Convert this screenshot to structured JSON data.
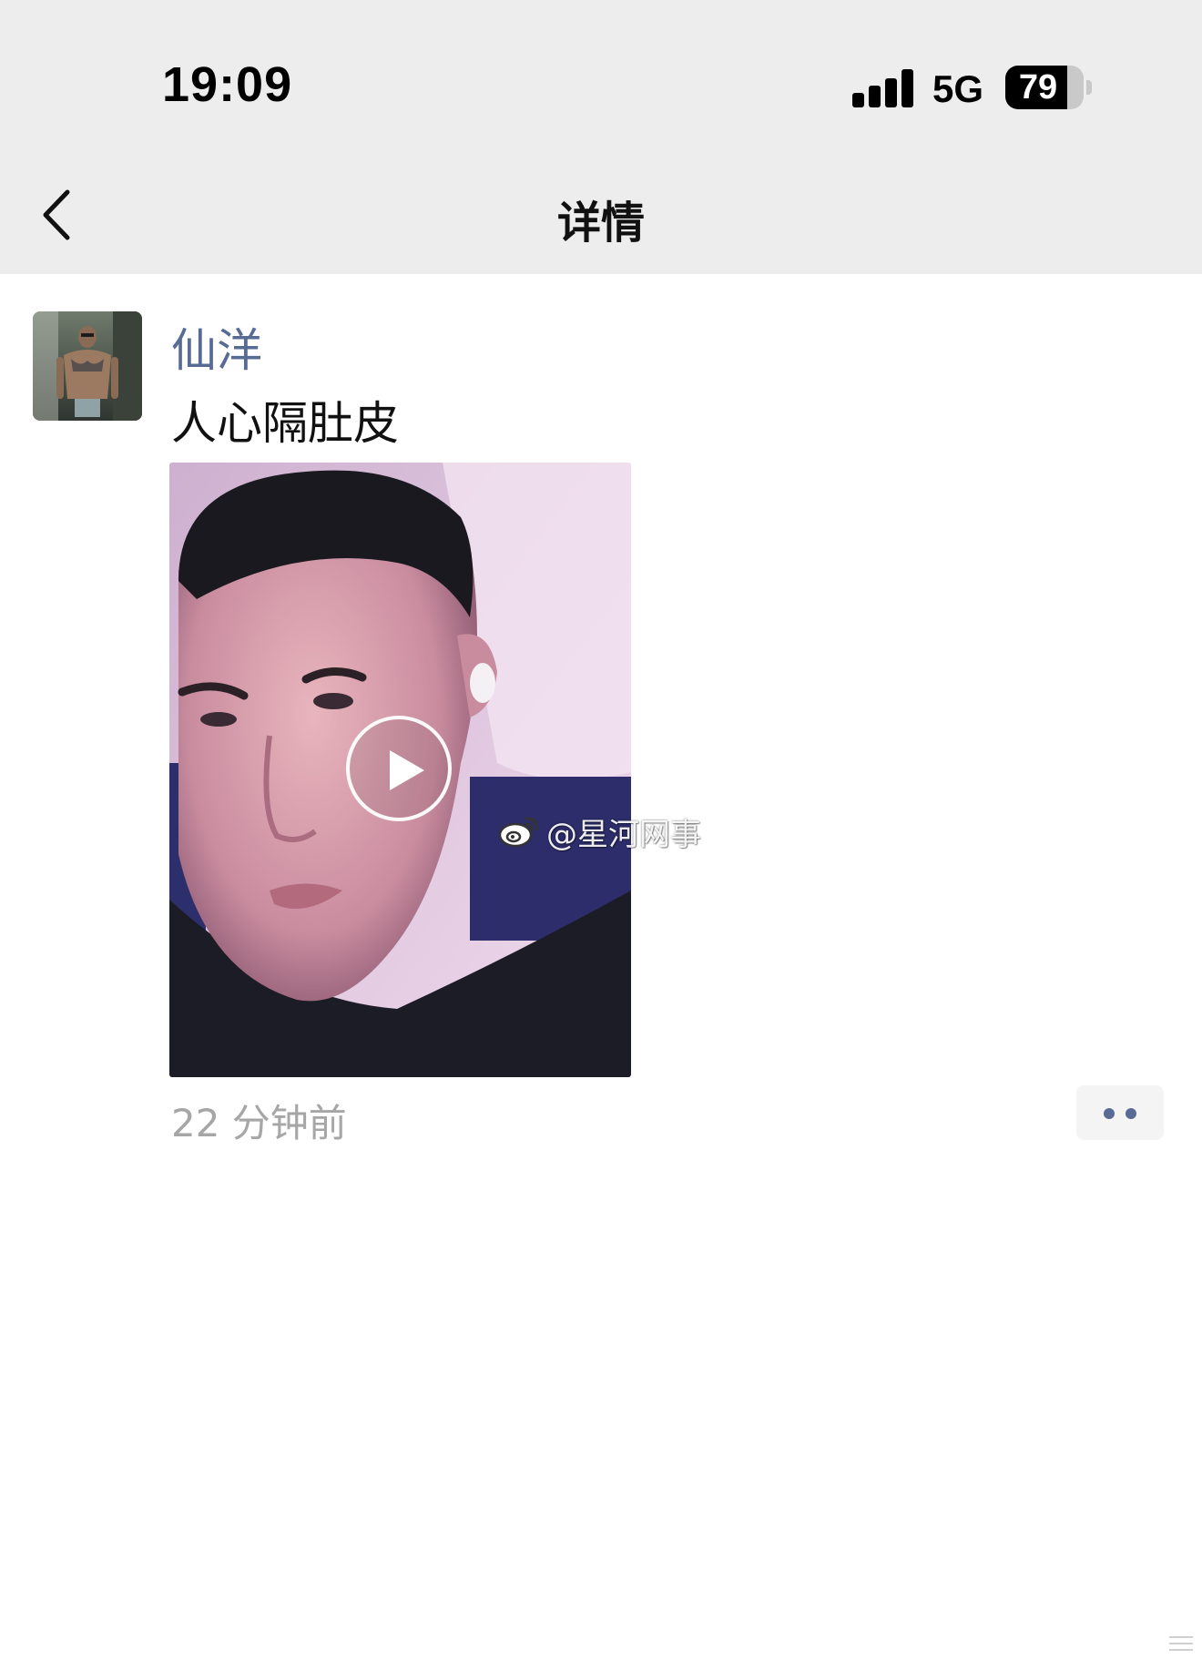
{
  "status_bar": {
    "time": "19:09",
    "network": "5G",
    "battery_level": "79",
    "battery_fraction": 0.79
  },
  "nav": {
    "title": "详情",
    "back_icon": "chevron-left-icon"
  },
  "post": {
    "author": "仙洋",
    "text": "人心隔肚皮",
    "video": {
      "play_icon": "play-icon",
      "watermark": "@星河网事"
    },
    "timestamp": "22 分钟前",
    "more_icon": "more-dots-icon"
  },
  "colors": {
    "link_blue": "#576b95",
    "nav_bg": "#ededed",
    "timestamp_gray": "#a6a6a6"
  }
}
